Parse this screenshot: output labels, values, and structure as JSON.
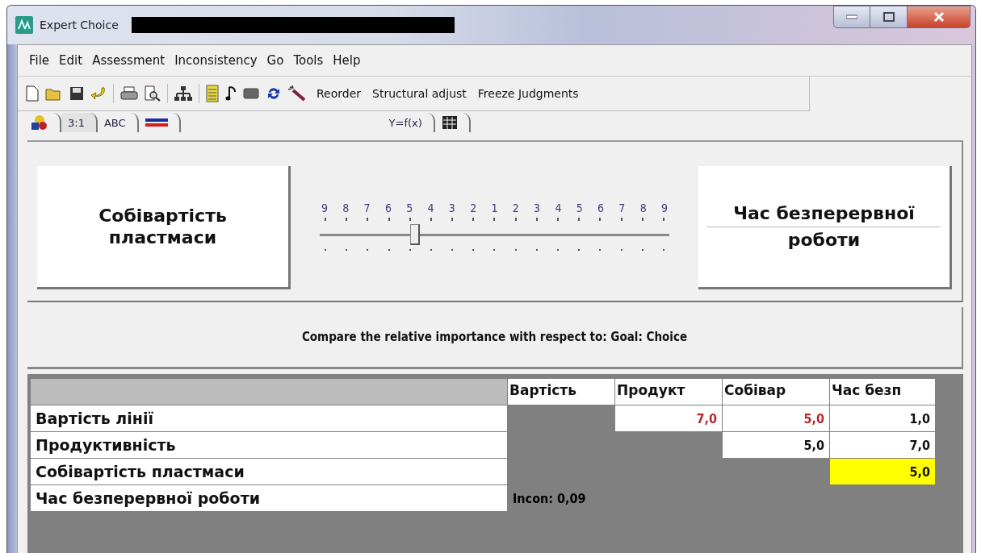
{
  "window": {
    "title": "Expert Choice"
  },
  "menu": [
    "File",
    "Edit",
    "Assessment",
    "Inconsistency",
    "Go",
    "Tools",
    "Help"
  ],
  "toolbar": {
    "commands": [
      "Reorder",
      "Structural adjust",
      "Freeze Judgments"
    ]
  },
  "tabs": [
    {
      "kind": "shapes",
      "selected": false
    },
    {
      "kind": "text",
      "label": "3:1",
      "selected": true
    },
    {
      "kind": "text",
      "label": "ABC",
      "selected": false
    },
    {
      "kind": "bars",
      "selected": false
    },
    {
      "kind": "text",
      "label": "Y=f(x)",
      "selected": false
    },
    {
      "kind": "grid",
      "selected": false
    }
  ],
  "comparison": {
    "left": "Собівартість пластмаси",
    "right_lines": [
      "Час безперервної",
      "роботи"
    ],
    "scale": [
      "9",
      "8",
      "7",
      "6",
      "5",
      "4",
      "3",
      "2",
      "1",
      "2",
      "3",
      "4",
      "5",
      "6",
      "7",
      "8",
      "9"
    ],
    "level": 0.275
  },
  "instruction": "Compare the relative importance  with respect to: Goal: Choice",
  "matrix": {
    "columns": [
      "Вартість",
      "Продукт",
      "Собівар",
      "Час безп"
    ],
    "rows": [
      {
        "label": "Вартість лінії",
        "cells": [
          {
            "kind": "empty"
          },
          {
            "kind": "value",
            "text": "7,0",
            "color": "#b8282e",
            "selected": false
          },
          {
            "kind": "value",
            "text": "5,0",
            "color": "#b8282e",
            "selected": false
          },
          {
            "kind": "value",
            "text": "1,0",
            "color": "#111111",
            "selected": false
          }
        ]
      },
      {
        "label": "Продуктивність",
        "cells": [
          {
            "kind": "empty"
          },
          {
            "kind": "empty"
          },
          {
            "kind": "value",
            "text": "5,0",
            "color": "#111111",
            "selected": false
          },
          {
            "kind": "value",
            "text": "7,0",
            "color": "#111111",
            "selected": false
          }
        ]
      },
      {
        "label": "Собівартість пластмаси",
        "cells": [
          {
            "kind": "empty"
          },
          {
            "kind": "empty"
          },
          {
            "kind": "empty"
          },
          {
            "kind": "value",
            "text": "5,0",
            "color": "#111111",
            "selected": true
          }
        ]
      },
      {
        "label": "Час безперервної роботи",
        "cells": [
          {
            "kind": "note",
            "text": "Incon: 0,09"
          },
          {
            "kind": "empty"
          },
          {
            "kind": "empty"
          },
          {
            "kind": "empty"
          }
        ]
      }
    ]
  }
}
